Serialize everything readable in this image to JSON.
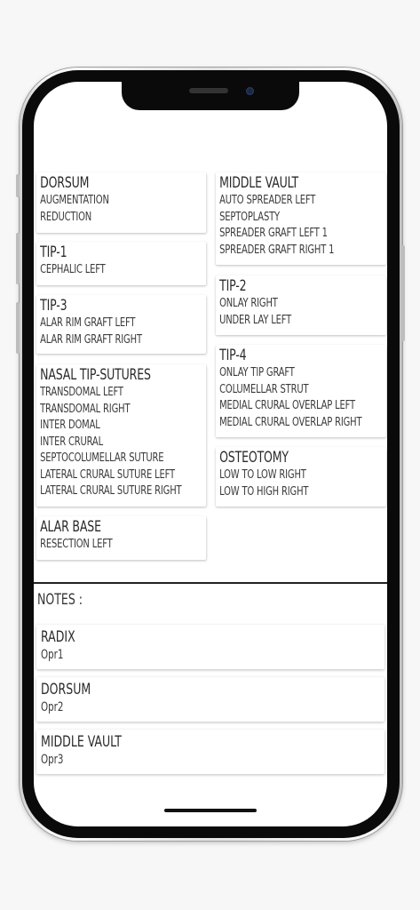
{
  "left_column": [
    {
      "title": "DORSUM",
      "items": [
        "AUGMENTATION",
        "REDUCTION"
      ]
    },
    {
      "title": "TIP-1",
      "items": [
        "CEPHALIC LEFT"
      ]
    },
    {
      "title": "TIP-3",
      "items": [
        "ALAR RIM GRAFT LEFT",
        "ALAR RIM GRAFT RIGHT"
      ]
    },
    {
      "title": "NASAL TIP-SUTURES",
      "items": [
        "TRANSDOMAL LEFT",
        "TRANSDOMAL RIGHT",
        "INTER DOMAL",
        "INTER CRURAL",
        "SEPTOCOLUMELLAR SUTURE",
        "LATERAL CRURAL SUTURE LEFT",
        "LATERAL CRURAL SUTURE RIGHT"
      ]
    },
    {
      "title": "ALAR BASE",
      "items": [
        "RESECTION LEFT"
      ]
    }
  ],
  "right_column": [
    {
      "title": "MIDDLE VAULT",
      "items": [
        "AUTO SPREADER LEFT",
        "SEPTOPLASTY",
        "SPREADER GRAFT LEFT 1",
        "SPREADER GRAFT RIGHT 1"
      ]
    },
    {
      "title": "TIP-2",
      "items": [
        "ONLAY RIGHT",
        "UNDER LAY LEFT"
      ]
    },
    {
      "title": "TIP-4",
      "items": [
        "ONLAY TIP GRAFT",
        "COLUMELLAR STRUT",
        "MEDIAL CRURAL OVERLAP LEFT",
        "MEDIAL CRURAL OVERLAP RIGHT"
      ]
    },
    {
      "title": "OSTEOTOMY",
      "items": [
        "LOW TO LOW RIGHT",
        "LOW TO HIGH RIGHT"
      ]
    }
  ],
  "notes": {
    "label": "NOTES :",
    "entries": [
      {
        "title": "RADIX",
        "text": "Opr1"
      },
      {
        "title": "DORSUM",
        "text": "Opr2"
      },
      {
        "title": "MIDDLE VAULT",
        "text": "Opr3"
      }
    ]
  }
}
